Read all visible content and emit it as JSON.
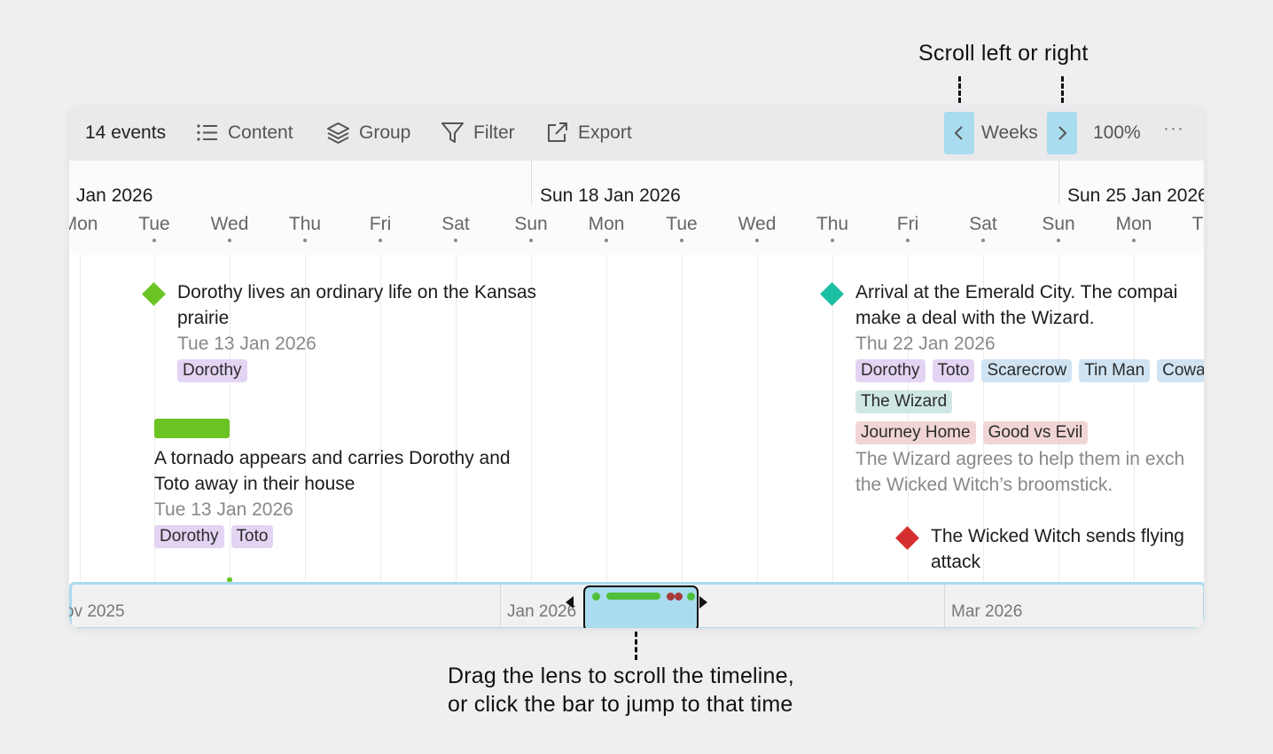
{
  "callouts": {
    "top": "Scroll left or right",
    "bottom_line1": "Drag the lens to scroll the timeline,",
    "bottom_line2": "or click the bar to jump to that time"
  },
  "toolbar": {
    "event_count": "14 events",
    "content_label": "Content",
    "group_label": "Group",
    "filter_label": "Filter",
    "export_label": "Export",
    "scale_label": "Weeks",
    "zoom": "100%",
    "more": "···"
  },
  "header": {
    "weeks": [
      "Jan 2026",
      "Sun 18 Jan 2026",
      "Sun 25 Jan 2026"
    ],
    "days": [
      "Mon",
      "Tue",
      "Wed",
      "Thu",
      "Fri",
      "Sat",
      "Sun",
      "Mon",
      "Tue",
      "Wed",
      "Thu",
      "Fri",
      "Sat",
      "Sun",
      "Mon",
      "T"
    ]
  },
  "events": {
    "e1": {
      "title_line1": "Dorothy lives an ordinary life on the Kansas",
      "title_line2": "prairie",
      "date": "Tue 13 Jan 2026",
      "tags": [
        "Dorothy"
      ]
    },
    "e2": {
      "title_line1": "A tornado appears and carries Dorothy and",
      "title_line2": "Toto away in their house",
      "date": "Tue 13 Jan 2026",
      "tags": [
        "Dorothy",
        "Toto"
      ]
    },
    "e3": {
      "title_line1": "Arrival at the Emerald City. The compai",
      "title_line2": "make a deal with the Wizard.",
      "date": "Thu 22 Jan 2026",
      "tags_row1": [
        "Dorothy",
        "Toto",
        "Scarecrow",
        "Tin Man",
        "Cowa"
      ],
      "tags_row2": [
        "The Wizard"
      ],
      "tags_row3": [
        "Journey Home",
        "Good vs Evil"
      ],
      "desc_line1": "The Wizard agrees to help them in exch",
      "desc_line2": "the Wicked Witch’s broomstick."
    },
    "e4": {
      "title_line1": "The Wicked Witch sends flying",
      "title_line2": "attack"
    }
  },
  "minimap": {
    "labels": [
      "ov 2025",
      "Jan 2026",
      "Mar 2026"
    ]
  },
  "colors": {
    "accent": "#a9dcee",
    "green": "#6cc424",
    "teal": "#1bbfa4",
    "red": "#d62e2e",
    "minimap_green": "#4fbf3a",
    "minimap_red": "#a83a3a"
  },
  "icons": {
    "content": "list-icon",
    "group": "layers-icon",
    "filter": "funnel-icon",
    "export": "external-link-icon",
    "prev": "chevron-left-icon",
    "next": "chevron-right-icon"
  }
}
